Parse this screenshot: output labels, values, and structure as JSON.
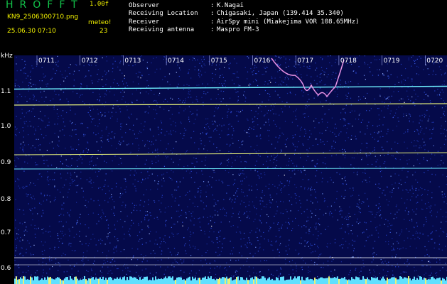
{
  "header": {
    "app_title": "HROFFT",
    "version": "1.00f",
    "filename": "KN9_2506300710.png",
    "meteo_label": "meteo!",
    "timestamp": "25.06.30 07:10",
    "meteo_count": "23"
  },
  "info": [
    {
      "label": "Observer",
      "value": "K.Nagai"
    },
    {
      "label": "Receiving Location",
      "value": "Chigasaki, Japan (139.414 35.340)"
    },
    {
      "label": "Receiver",
      "value": "AirSpy mini (Miakejima VOR 108.65MHz)"
    },
    {
      "label": "Receiving antenna",
      "value": "Maspro FM-3"
    }
  ],
  "axes": {
    "y_unit": "kHz",
    "y_ticks": [
      "1.1",
      "1.0",
      "0.9",
      "0.8",
      "0.7",
      "0.6"
    ],
    "x_ticks": [
      "0711",
      "0712",
      "0713",
      "0714",
      "0715",
      "0716",
      "0717",
      "0718",
      "0719",
      "0720"
    ]
  },
  "colors": {
    "background": "#000000",
    "plot_bg": "#050a4a",
    "text_yellow": "#f0f000",
    "title_green": "#12c24a",
    "trace_cyan": "#6ff0ff",
    "trace_yellow": "#e6f07a",
    "meteor_magenta": "#d26bd2"
  },
  "features": {
    "horizontal_traces_khz": [
      1.095,
      1.05,
      0.91,
      0.87,
      0.62
    ],
    "meteor_echo": "0716-0718"
  }
}
